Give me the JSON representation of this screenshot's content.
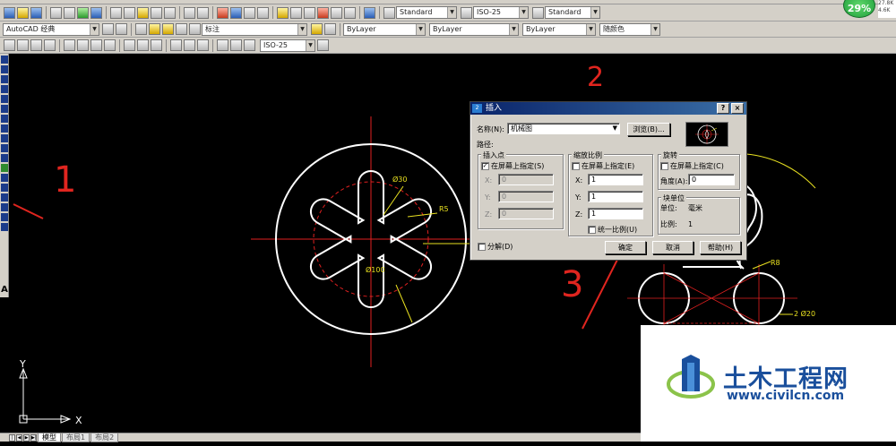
{
  "toolbar1": {
    "text_style": "Standard",
    "dim_style": "ISO-25",
    "table_style": "Standard"
  },
  "toolbar2": {
    "workspace": "AutoCAD 经典",
    "layer": "标注",
    "color": "ByLayer",
    "linetype": "ByLayer",
    "lineweight": "ByLayer",
    "plot_style": "随颜色"
  },
  "toolbar3": {
    "dim_style": "ISO-25"
  },
  "status": {
    "percent": "29%",
    "net_up": "27.8K",
    "net_down": "4.6K"
  },
  "bottom_tabs": [
    "模型",
    "布局1",
    "布局2"
  ],
  "ucs": {
    "x_label": "X",
    "y_label": "Y"
  },
  "drawing": {
    "colors": {
      "outline": "#ffffff",
      "center": "#e02020",
      "dim": "#e8e020"
    },
    "dims": {
      "d30": "Ø30",
      "r5": "R5",
      "d100": "Ø100",
      "r8": "R8",
      "d20": "2 Ø20"
    }
  },
  "dialog": {
    "title": "插入",
    "help_btn": "?",
    "close_btn": "×",
    "name_label": "名称(N):",
    "name_value": "机械图",
    "browse_btn": "浏览(B)...",
    "path_label": "路径:",
    "insert_point": {
      "title": "插入点",
      "on_screen": "在屏幕上指定(S)",
      "on_screen_checked": true,
      "x_label": "X:",
      "x_value": "0",
      "y_label": "Y:",
      "y_value": "0",
      "z_label": "Z:",
      "z_value": "0"
    },
    "scale": {
      "title": "缩放比例",
      "on_screen": "在屏幕上指定(E)",
      "on_screen_checked": false,
      "x_label": "X:",
      "x_value": "1",
      "y_label": "Y:",
      "y_value": "1",
      "z_label": "Z:",
      "z_value": "1",
      "uniform": "统一比例(U)"
    },
    "rotation": {
      "title": "旋转",
      "on_screen": "在屏幕上指定(C)",
      "on_screen_checked": false,
      "angle_label": "角度(A):",
      "angle_value": "0"
    },
    "block_unit": {
      "title": "块单位",
      "unit_label": "单位:",
      "unit_value": "毫米",
      "factor_label": "比例:",
      "factor_value": "1"
    },
    "explode": "分解(D)",
    "ok_btn": "确定",
    "cancel_btn": "取消",
    "help_button": "帮助(H)"
  },
  "annotations": {
    "a1": "1",
    "a2": "2",
    "a3": "3"
  },
  "watermark": {
    "title": "土木工程网",
    "url": "www.civilcn.com"
  }
}
